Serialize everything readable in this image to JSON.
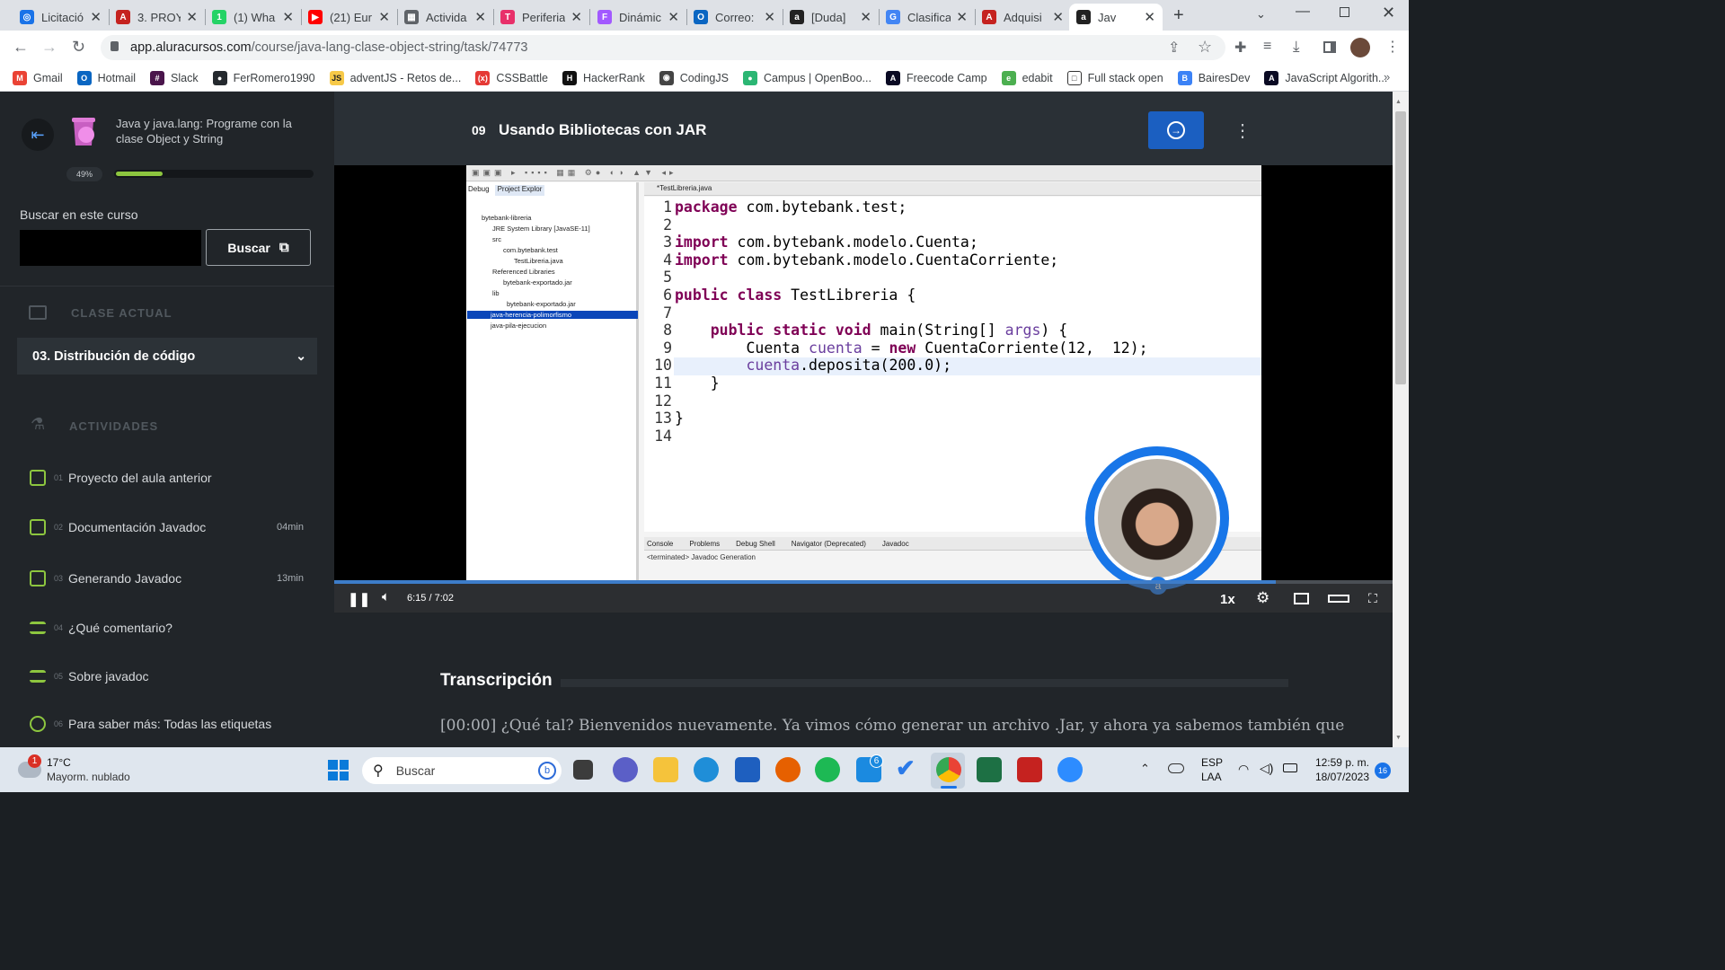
{
  "browser": {
    "tabs": [
      {
        "label": "Licitació",
        "color": "#1a73e8",
        "glyph": "◎"
      },
      {
        "label": "3. PROY",
        "color": "#c5221f",
        "glyph": "A"
      },
      {
        "label": "(1) Wha",
        "color": "#25d366",
        "glyph": "1"
      },
      {
        "label": "(21) Eur",
        "color": "#ff0000",
        "glyph": "▶"
      },
      {
        "label": "Activida",
        "color": "#5f6368",
        "glyph": "▦"
      },
      {
        "label": "Periferia",
        "color": "#e8306a",
        "glyph": "T"
      },
      {
        "label": "Dinámic",
        "color": "#a259ff",
        "glyph": "F"
      },
      {
        "label": "Correo:",
        "color": "#0a66c2",
        "glyph": "O"
      },
      {
        "label": "[Duda] ",
        "color": "#222222",
        "glyph": "a"
      },
      {
        "label": "Clasifica",
        "color": "#4285f4",
        "glyph": "G"
      },
      {
        "label": "Adquisi",
        "color": "#c5221f",
        "glyph": "A"
      },
      {
        "label": "Jav",
        "color": "#222222",
        "glyph": "a"
      }
    ],
    "url_host": "app.aluracursos.com",
    "url_path": "/course/java-lang-clase-object-string/task/74773",
    "bookmarks": [
      {
        "label": "Gmail",
        "color": "#ea4335",
        "glyph": "M"
      },
      {
        "label": "Hotmail",
        "color": "#0a66c2",
        "glyph": "O"
      },
      {
        "label": "Slack",
        "color": "#4a154b",
        "glyph": "#"
      },
      {
        "label": "FerRomero1990",
        "color": "#24292e",
        "glyph": "●"
      },
      {
        "label": "adventJS - Retos de...",
        "color": "#f7c948",
        "glyph": "JS"
      },
      {
        "label": "CSSBattle",
        "color": "#e53935",
        "glyph": "(x)"
      },
      {
        "label": "HackerRank",
        "color": "#111111",
        "glyph": "H"
      },
      {
        "label": "CodingJS",
        "color": "#444444",
        "glyph": "◉"
      },
      {
        "label": "Campus | OpenBoo...",
        "color": "#2bb673",
        "glyph": "●"
      },
      {
        "label": "Freecode Camp",
        "color": "#0a0a23",
        "glyph": "A"
      },
      {
        "label": "edabit",
        "color": "#4caf50",
        "glyph": "e"
      },
      {
        "label": "Full stack open",
        "color": "#ffffff",
        "glyph": "□"
      },
      {
        "label": "BairesDev",
        "color": "#3b82f6",
        "glyph": "B"
      },
      {
        "label": "JavaScript Algorith...",
        "color": "#0a0a23",
        "glyph": "A"
      }
    ]
  },
  "sidebar": {
    "course_title": "Java y java.lang: Programe con la clase Object y String",
    "progress_label": "49%",
    "progress_value": 0.49,
    "search_label": "Buscar en este curso",
    "search_button": "Buscar",
    "current_section_label": "CLASE ACTUAL",
    "current_lesson": "03. Distribución de código",
    "activities_label": "ACTIVIDADES",
    "activities": [
      {
        "num": "01",
        "label": "Proyecto del aula anterior",
        "duration": ""
      },
      {
        "num": "02",
        "label": "Documentación Javadoc",
        "duration": "04min"
      },
      {
        "num": "03",
        "label": "Generando Javadoc",
        "duration": "13min"
      },
      {
        "num": "04",
        "label": "¿Qué comentario?",
        "duration": ""
      },
      {
        "num": "05",
        "label": "Sobre javadoc",
        "duration": ""
      },
      {
        "num": "06",
        "label": "Para saber más: Todas las etiquetas",
        "duration": ""
      }
    ]
  },
  "main": {
    "task_number": "09",
    "task_title": "Usando Bibliotecas con JAR"
  },
  "video": {
    "time_current": "6:15",
    "time_total": "7:02",
    "progress": 0.89,
    "speed": "1x",
    "ide": {
      "editor_tab": "*TestLibreria.java",
      "explorer_tabs": [
        "Debug",
        "Project Explor"
      ],
      "tree": [
        "bytebank-libreria",
        "JRE System Library [JavaSE-11]",
        "src",
        "com.bytebank.test",
        "TestLibreria.java",
        "Referenced Libraries",
        "bytebank-exportado.jar",
        "lib",
        "bytebank-exportado.jar",
        "java-herencia-polimorfismo",
        "java-pila-ejecucion"
      ],
      "code": [
        "package com.bytebank.test;",
        "",
        "import com.bytebank.modelo.Cuenta;",
        "import com.bytebank.modelo.CuentaCorriente;",
        "",
        "public class TestLibreria {",
        "",
        "    public static void main(String[] args) {",
        "        Cuenta cuenta = new CuentaCorriente(12,  12);",
        "        cuenta.deposita(200.0);",
        "    }",
        "",
        "}",
        ""
      ],
      "bottom_tabs": [
        "Console",
        "Problems",
        "Debug Shell",
        "Navigator (Deprecated)",
        "Javadoc"
      ],
      "console_text": "<terminated> Javadoc Generation"
    }
  },
  "transcript": {
    "title": "Transcripción",
    "text": "[00:00] ¿Qué tal? Bienvenidos nuevamente. Ya vimos cómo generar un archivo .Jar, y ahora ya sabemos también que"
  },
  "taskbar": {
    "weather_temp": "17°C",
    "weather_desc": "Mayorm. nublado",
    "weather_badge": "1",
    "search_placeholder": "Buscar",
    "lang_top": "ESP",
    "lang_bottom": "LAA",
    "time": "12:59 p. m.",
    "date": "18/07/2023",
    "notif_count": "16",
    "badge_6": "6"
  }
}
